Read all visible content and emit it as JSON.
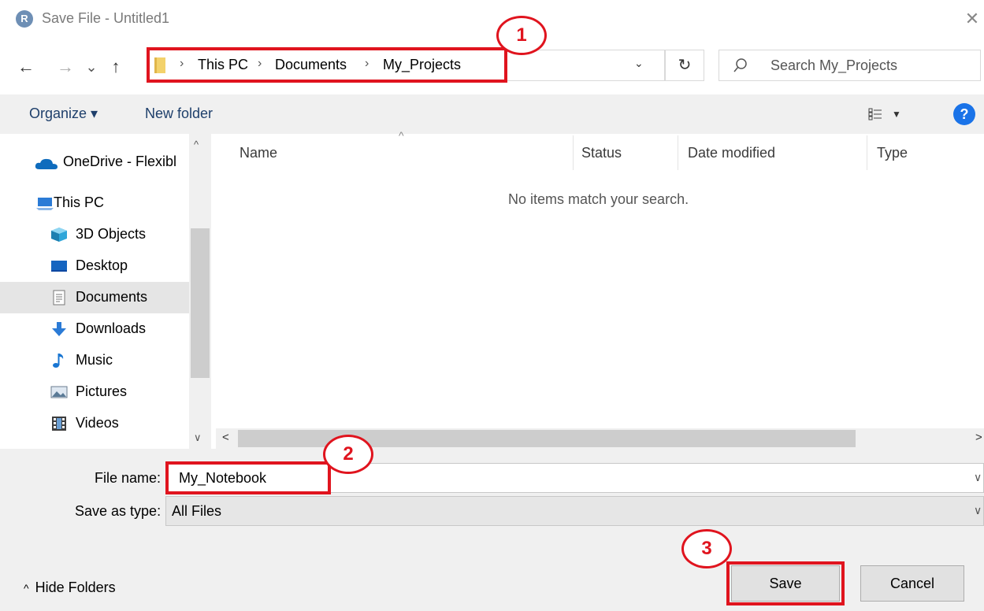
{
  "window": {
    "app_icon_letter": "R",
    "title": "Save File - Untitled1",
    "close_glyph": "✕"
  },
  "navigation": {
    "back": "←",
    "forward": "→",
    "recent": "⌄",
    "up": "↑",
    "breadcrumb": [
      "This PC",
      "Documents",
      "My_Projects"
    ],
    "refresh": "↻",
    "search_placeholder": "Search My_Projects"
  },
  "toolbar": {
    "organize": "Organize ▾",
    "new_folder": "New folder",
    "help": "?"
  },
  "sidebar": {
    "items": [
      {
        "label": "OneDrive - Flexibl",
        "icon": "cloud-icon",
        "selected": false
      },
      {
        "label": "This PC",
        "icon": "computer-icon",
        "selected": false
      },
      {
        "label": "3D Objects",
        "icon": "cube-icon",
        "selected": false
      },
      {
        "label": "Desktop",
        "icon": "desktop-icon",
        "selected": false
      },
      {
        "label": "Documents",
        "icon": "document-icon",
        "selected": true
      },
      {
        "label": "Downloads",
        "icon": "download-icon",
        "selected": false
      },
      {
        "label": "Music",
        "icon": "music-icon",
        "selected": false
      },
      {
        "label": "Pictures",
        "icon": "picture-icon",
        "selected": false
      },
      {
        "label": "Videos",
        "icon": "video-icon",
        "selected": false
      }
    ]
  },
  "file_list": {
    "columns": [
      "Name",
      "Status",
      "Date modified",
      "Type"
    ],
    "empty_message": "No items match your search."
  },
  "form": {
    "file_name_label": "File name:",
    "file_name_value": "My_Notebook",
    "save_type_label": "Save as type:",
    "save_type_value": "All Files"
  },
  "buttons": {
    "hide_folders": "Hide Folders",
    "save": "Save",
    "cancel": "Cancel"
  },
  "annotations": {
    "badges": [
      "1",
      "2",
      "3"
    ],
    "color": "#e0141e"
  }
}
